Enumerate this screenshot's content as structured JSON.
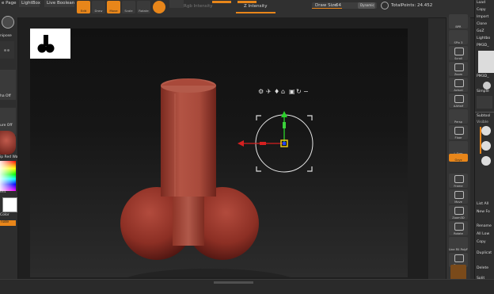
{
  "topbar": {
    "left_cut": "e Page",
    "lightbox": "LightBox",
    "live_boolean": "Live Boolean",
    "edit": "Edit",
    "draw": "Draw",
    "move": "Move",
    "scale": "Scale",
    "rotate": "Rotate",
    "rgb_intensity": "Rgb Intensity",
    "z_intensity": "Z Intensity",
    "draw_size_label": "Draw Size",
    "draw_size_value": "64",
    "dynamic": "Dynamic",
    "total_points": "TotalPoints: 24.452"
  },
  "leftpanel": {
    "thumb_label": "nipose",
    "tab_a": "ha Off",
    "tab_b": "ure Off",
    "tab_c": "ip Red Wa",
    "tab_d": "ent",
    "tab_e": "Color",
    "tab_f": "nate"
  },
  "rightshelf": {
    "bpr": "BPR",
    "spix": "SPix 3",
    "scroll": "Scroll",
    "zoom": "Zoom",
    "actual": "Actual",
    "aahalf": "AAHalf",
    "persp": "Persp",
    "floor": "Floor",
    "local": "L.Sym",
    "gxyz": "Gxyz",
    "frame": "Frame",
    "move": "Move",
    "zoom3d": "Zoom3D",
    "rotate": "Rotate",
    "line_fill": "Line Fill PolyF",
    "transp": "Transp"
  },
  "rightpanel": {
    "load": "Load",
    "copy": "Copy",
    "import": "Import",
    "clone": "Clone",
    "goz": "GoZ",
    "lightbox": "Lightbo",
    "pm3d_a": "PM3D_",
    "pm3d_b": "PM3D_",
    "simple": "Simple",
    "subtool": "Subtool",
    "visible": "Visible",
    "list_all": "List All",
    "new_folder": "New Fo",
    "rename": "Rename",
    "all_low": "All Low",
    "copy2": "Copy",
    "duplicate": "Duplicat",
    "delete": "Delete",
    "split": "Split"
  },
  "colors": {
    "accent": "#e8861a",
    "model": "#9b3a2e",
    "background": "#2b2b2b"
  }
}
